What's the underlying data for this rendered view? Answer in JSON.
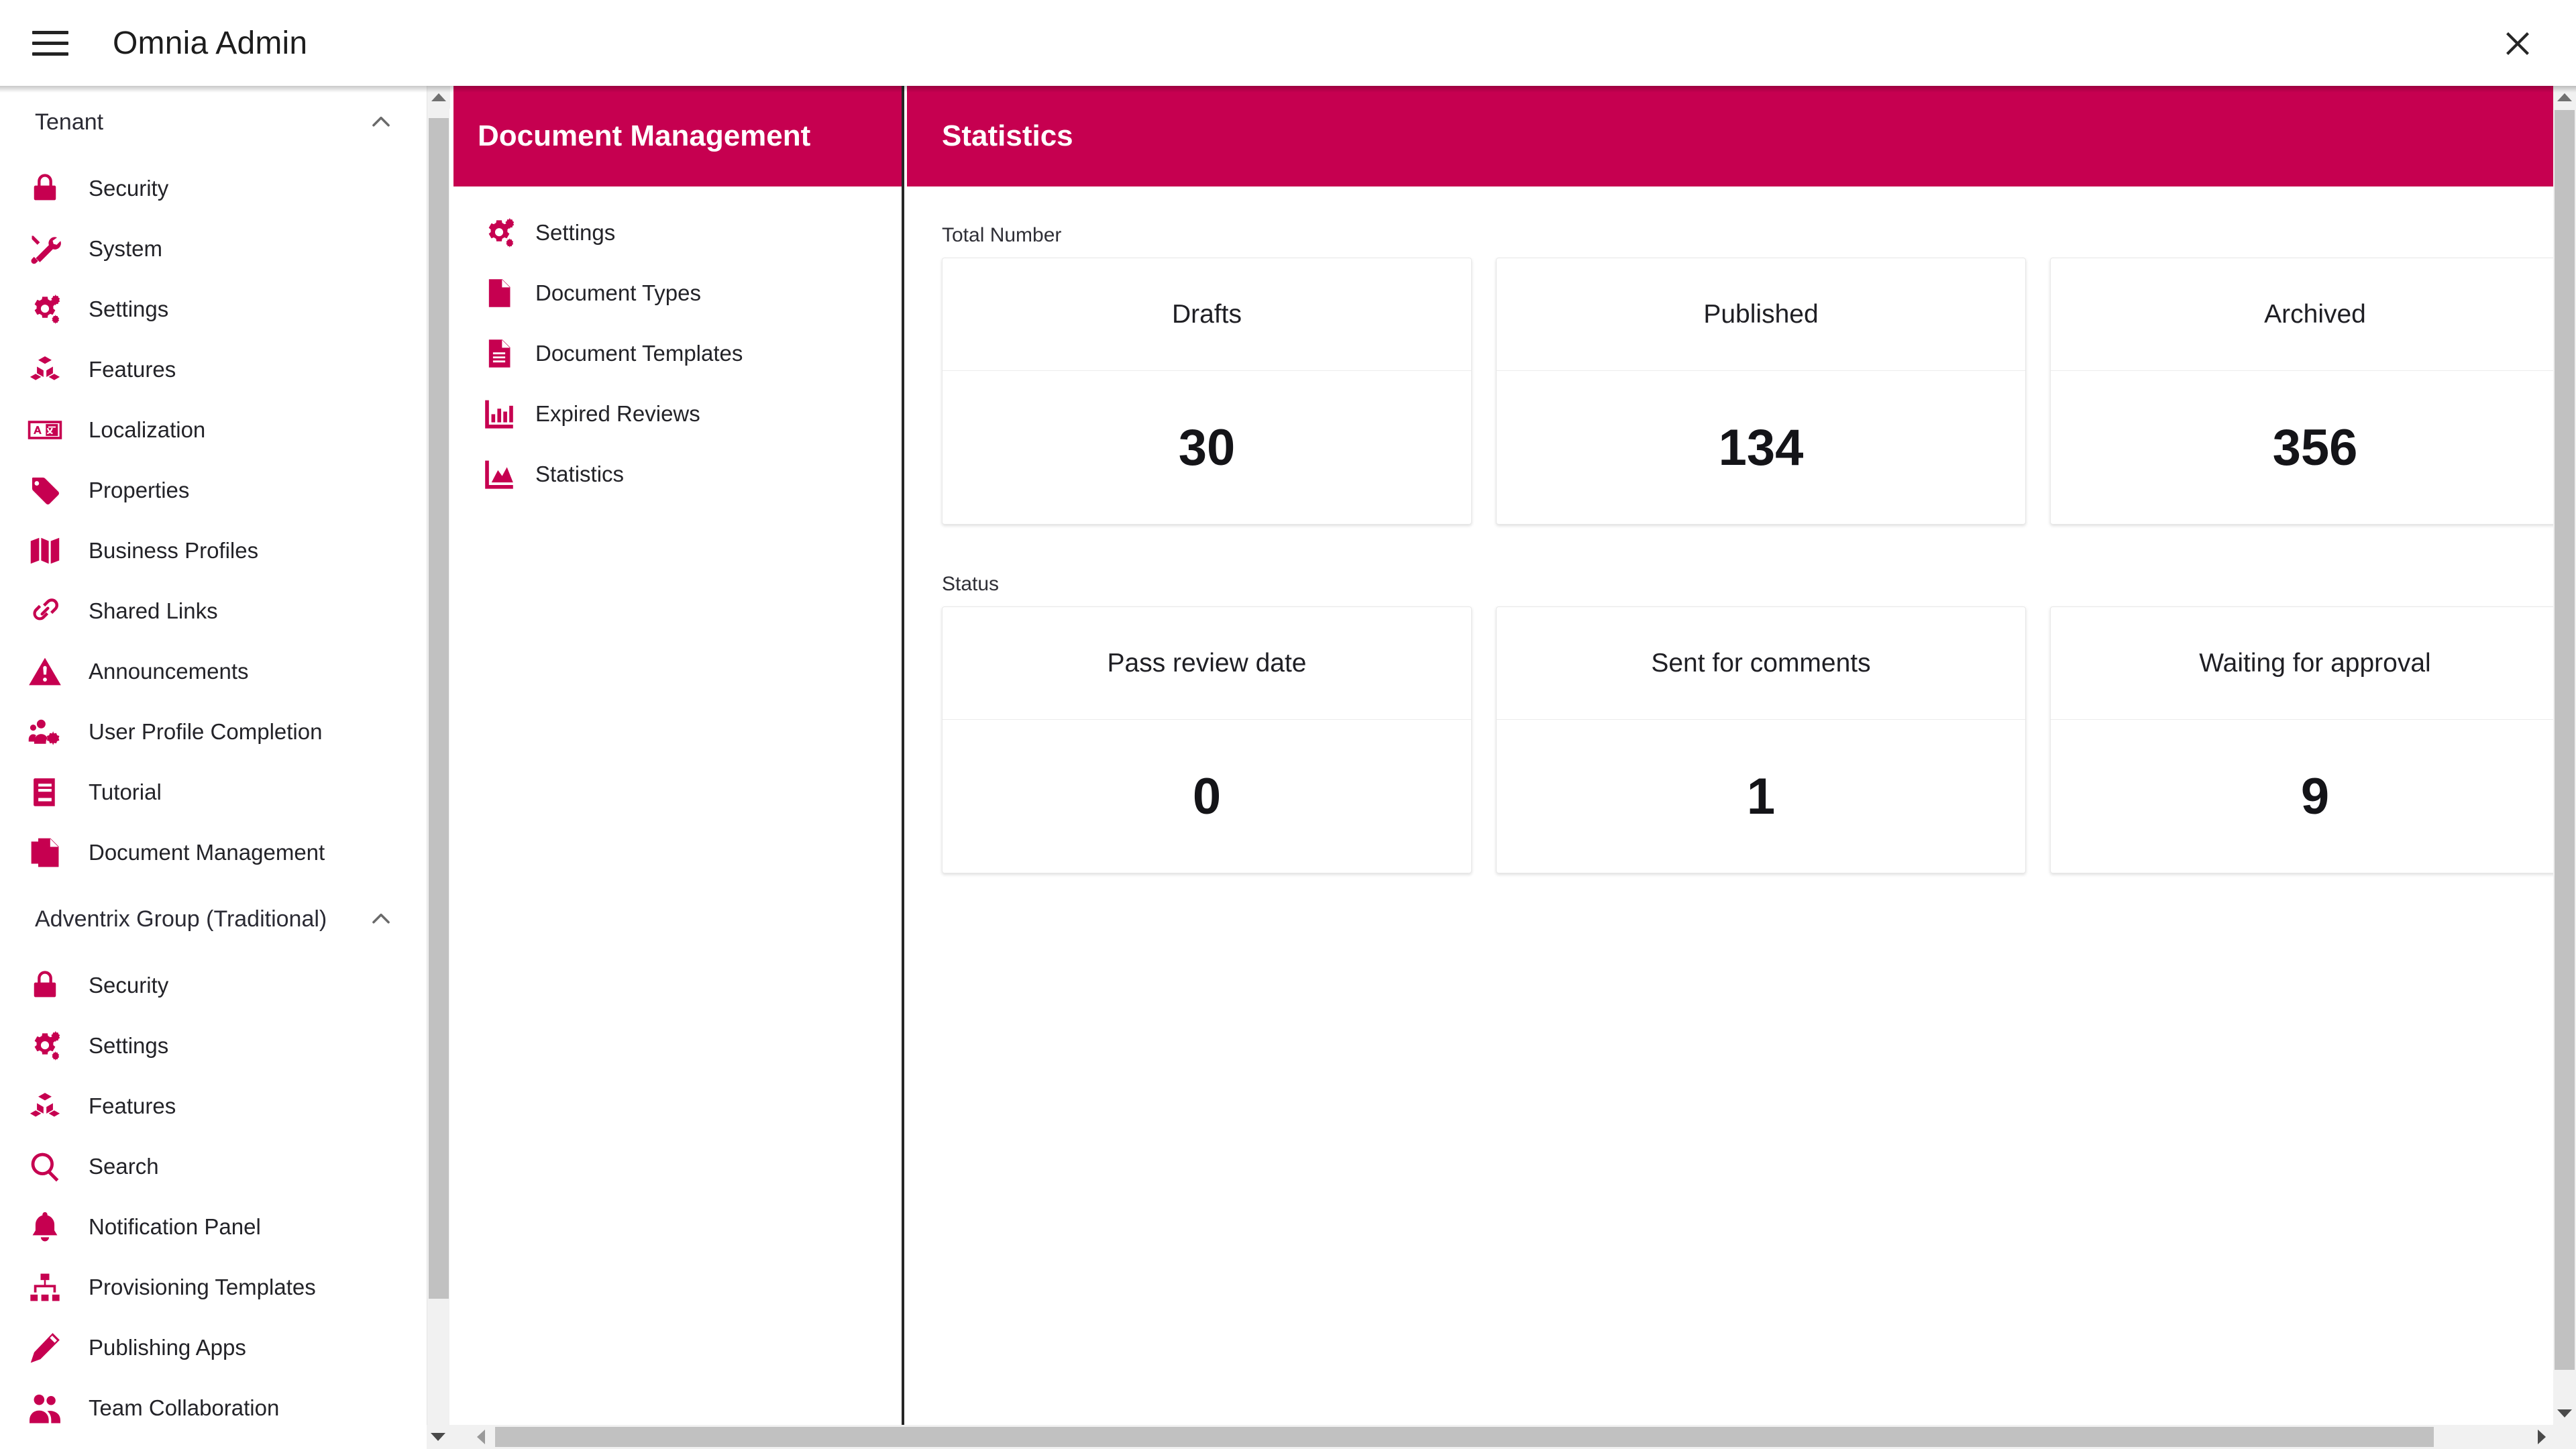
{
  "colors": {
    "brand": "#C60050",
    "text": "#232328",
    "headerText": "#ffffff",
    "scrollTrack": "#f1f1f1",
    "scrollThumb": "#c1c1c1"
  },
  "appbar": {
    "menu_icon": "hamburger-menu-icon",
    "title": "Omnia Admin",
    "close_icon": "close-icon"
  },
  "sidebar": {
    "groups": [
      {
        "title": "Tenant",
        "expanded": true,
        "chevron_icon": "chevron-up-icon",
        "items": [
          {
            "label": "Security",
            "icon": "lock-icon"
          },
          {
            "label": "System",
            "icon": "tools-icon"
          },
          {
            "label": "Settings",
            "icon": "gears-icon"
          },
          {
            "label": "Features",
            "icon": "blocks-icon"
          },
          {
            "label": "Localization",
            "icon": "translate-icon"
          },
          {
            "label": "Properties",
            "icon": "tag-icon"
          },
          {
            "label": "Business Profiles",
            "icon": "map-icon"
          },
          {
            "label": "Shared Links",
            "icon": "link-icon"
          },
          {
            "label": "Announcements",
            "icon": "warning-triangle-icon"
          },
          {
            "label": "User Profile Completion",
            "icon": "users-gear-icon"
          },
          {
            "label": "Tutorial",
            "icon": "book-icon"
          },
          {
            "label": "Document Management",
            "icon": "documents-icon"
          }
        ]
      },
      {
        "title": "Adventrix Group (Traditional)",
        "expanded": true,
        "chevron_icon": "chevron-up-icon",
        "items": [
          {
            "label": "Security",
            "icon": "lock-icon"
          },
          {
            "label": "Settings",
            "icon": "gears-icon"
          },
          {
            "label": "Features",
            "icon": "blocks-icon"
          },
          {
            "label": "Search",
            "icon": "search-icon"
          },
          {
            "label": "Notification Panel",
            "icon": "bell-icon"
          },
          {
            "label": "Provisioning Templates",
            "icon": "sitemap-icon"
          },
          {
            "label": "Publishing Apps",
            "icon": "pencil-icon"
          },
          {
            "label": "Team Collaboration",
            "icon": "people-icon"
          }
        ]
      }
    ]
  },
  "middle_panel": {
    "title": "Document Management",
    "items": [
      {
        "label": "Settings",
        "icon": "gears-icon"
      },
      {
        "label": "Document Types",
        "icon": "file-icon"
      },
      {
        "label": "Document Templates",
        "icon": "file-lines-icon"
      },
      {
        "label": "Expired Reviews",
        "icon": "bar-chart-icon"
      },
      {
        "label": "Statistics",
        "icon": "area-chart-icon"
      }
    ]
  },
  "statistics": {
    "title": "Statistics",
    "sections": [
      {
        "label": "Total Number",
        "cards": [
          {
            "title": "Drafts",
            "value": "30"
          },
          {
            "title": "Published",
            "value": "134"
          },
          {
            "title": "Archived",
            "value": "356"
          }
        ]
      },
      {
        "label": "Status",
        "cards": [
          {
            "title": "Pass review date",
            "value": "0"
          },
          {
            "title": "Sent for comments",
            "value": "1"
          },
          {
            "title": "Waiting for approval",
            "value": "9"
          }
        ]
      }
    ]
  },
  "scrollbars": {
    "left_up_icon": "triangle-up-icon",
    "left_down_icon": "triangle-down-icon",
    "right_up_icon": "triangle-up-icon",
    "right_down_icon": "triangle-down-icon",
    "h_left_icon": "triangle-left-icon",
    "h_right_icon": "triangle-right-icon"
  }
}
